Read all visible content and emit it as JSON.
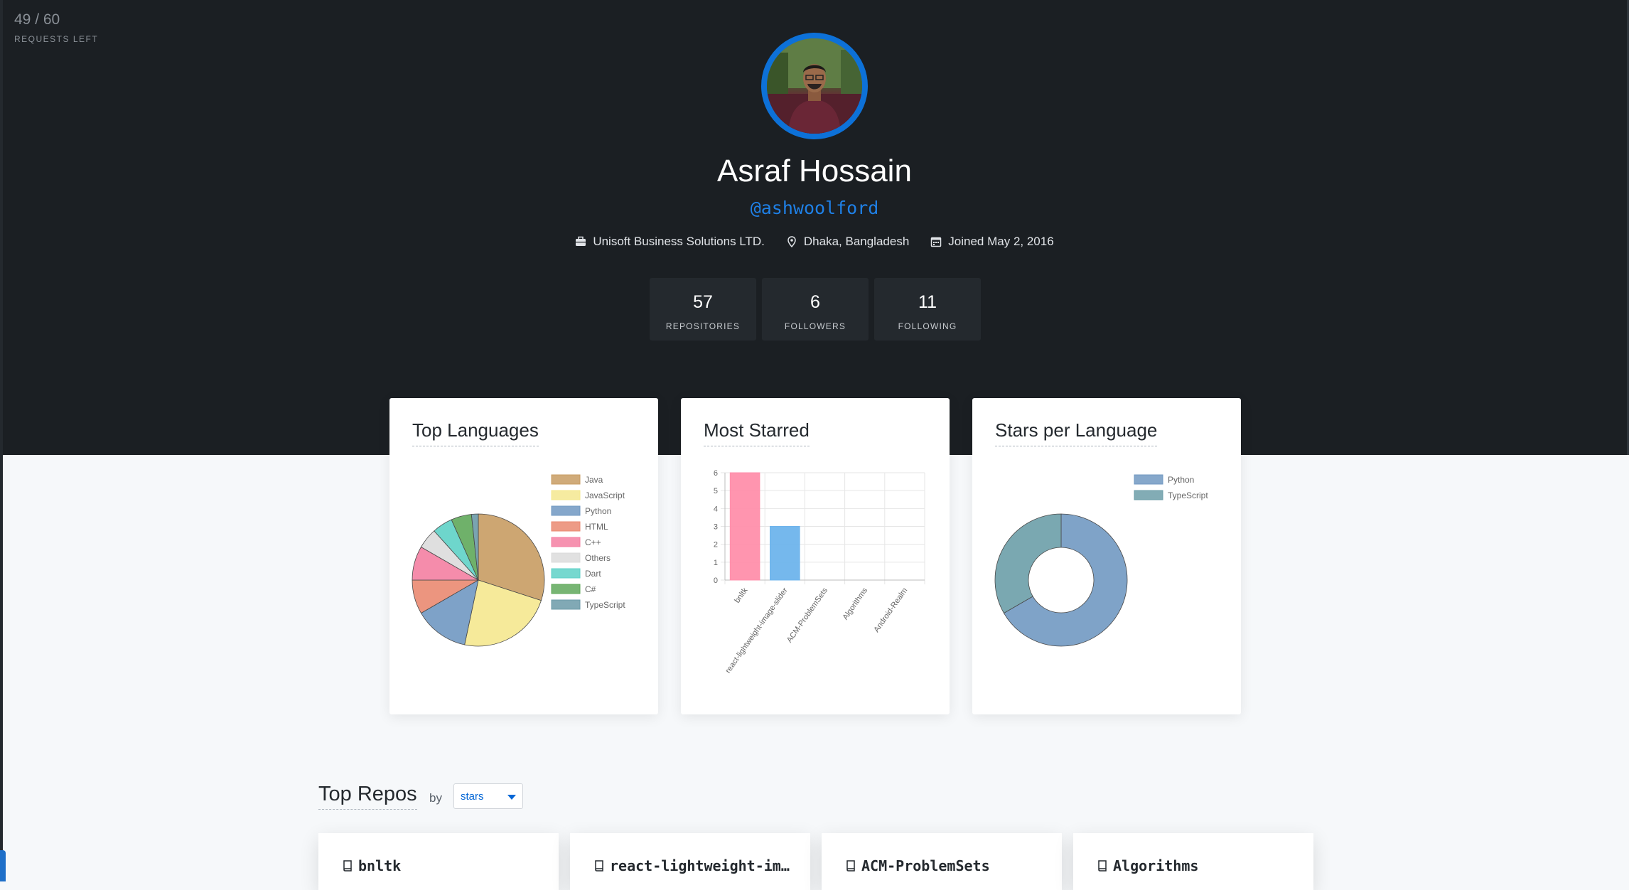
{
  "rate_limit": {
    "count": "49 / 60",
    "label": "REQUESTS LEFT"
  },
  "profile": {
    "name": "Asraf Hossain",
    "handle": "@ashwoolford",
    "company": "Unisoft Business Solutions LTD.",
    "location": "Dhaka, Bangladesh",
    "joined": "Joined May 2, 2016",
    "icons": [
      "briefcase-icon",
      "location-pin-icon",
      "calendar-icon"
    ]
  },
  "stats": [
    {
      "value": "57",
      "label": "REPOSITORIES"
    },
    {
      "value": "6",
      "label": "FOLLOWERS"
    },
    {
      "value": "11",
      "label": "FOLLOWING"
    }
  ],
  "cards": {
    "languages_title": "Top Languages",
    "starred_title": "Most Starred",
    "stars_title": "Stars per Language"
  },
  "chart_data": [
    {
      "type": "pie",
      "title": "Top Languages",
      "legend_position": "right",
      "labels": [
        "Java",
        "JavaScript",
        "Python",
        "HTML",
        "C++",
        "Others",
        "Dart",
        "C#",
        "TypeScript"
      ],
      "values": [
        18,
        14,
        8,
        5,
        5,
        3,
        3,
        3,
        1
      ],
      "colors": [
        "#c89c63",
        "#f5e88f",
        "#7098c2",
        "#ea8971",
        "#f47fa2",
        "#dcdcdc",
        "#5ed1c7",
        "#5fa85a",
        "#6b9aa8"
      ]
    },
    {
      "type": "bar",
      "title": "Most Starred",
      "categories": [
        "bnltk",
        "react-lightweight-image-slider",
        "ACM-ProblemSets",
        "Algorithms",
        "Android-Realm"
      ],
      "values": [
        6,
        3,
        0,
        0,
        0
      ],
      "colors": [
        "#ff8fab",
        "#6eb4ec",
        "#ffd36b",
        "#75d0c6",
        "#a98bf0"
      ],
      "ylim": [
        0,
        6
      ],
      "yticks": [
        "0",
        "1",
        "2",
        "3",
        "4",
        "5",
        "6"
      ],
      "grid": true
    },
    {
      "type": "pie",
      "title": "Stars per Language",
      "donut": true,
      "legend_position": "top-right",
      "labels": [
        "Python",
        "TypeScript"
      ],
      "values": [
        6,
        3
      ],
      "colors": [
        "#7199c2",
        "#6c9ea8"
      ]
    }
  ],
  "top_repos": {
    "title": "Top Repos",
    "by_label": "by",
    "sort_value": "stars",
    "items": [
      "bnltk",
      "react-lightweight-im…",
      "ACM-ProblemSets",
      "Algorithms"
    ]
  }
}
